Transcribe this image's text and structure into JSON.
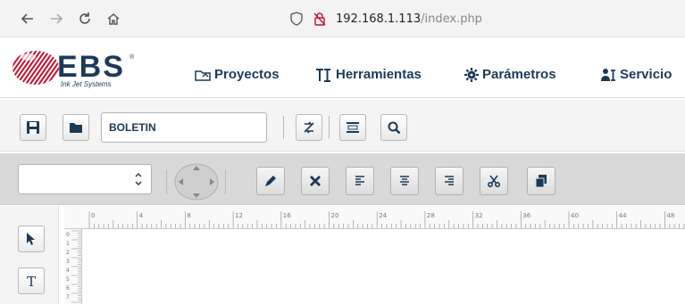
{
  "browser": {
    "url_host": "192.168.1.113",
    "url_path": "/index.php"
  },
  "app": {
    "logo_text": "EBS",
    "logo_subtitle": "Ink Jet Systems",
    "menu": [
      {
        "label": "Proyectos",
        "icon": "projects-icon"
      },
      {
        "label": "Herramientas",
        "icon": "tools-icon"
      },
      {
        "label": "Parámetros",
        "icon": "gear-icon"
      },
      {
        "label": "Servicio",
        "icon": "service-icon"
      }
    ],
    "accent_color": "#1b3a57",
    "logo_red": "#c8102e"
  },
  "toolbar1": {
    "project_name": "BOLETIN"
  },
  "toolbar2": {
    "font_select_value": ""
  },
  "rulers": {
    "h_labels": [
      "0",
      "4",
      "8",
      "12",
      "16",
      "20",
      "24",
      "28",
      "32",
      "36",
      "40",
      "44",
      "48"
    ],
    "v_labels": [
      "0",
      "1",
      "2",
      "3",
      "4",
      "5",
      "6",
      "7"
    ]
  }
}
